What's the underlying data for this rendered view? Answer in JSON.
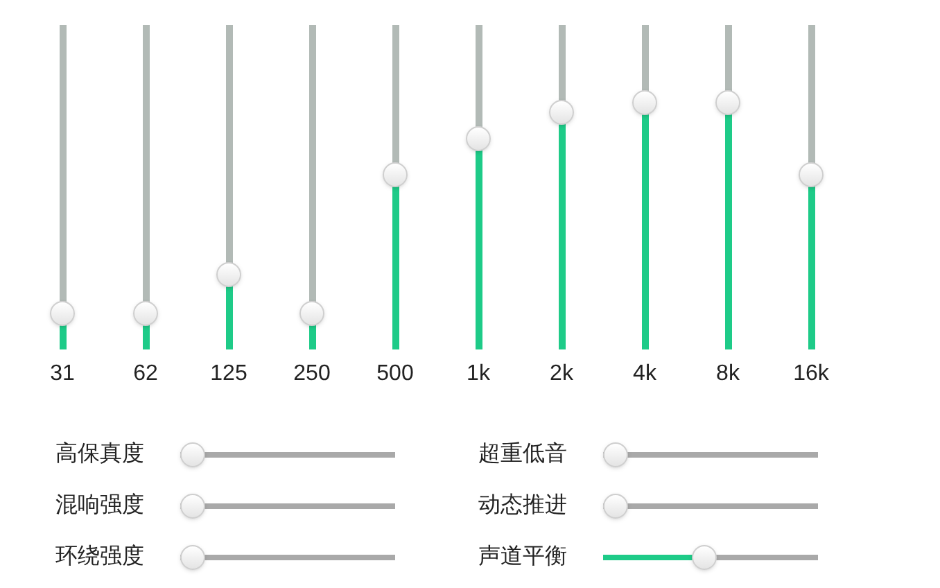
{
  "equalizer": [
    {
      "label": "31",
      "level": 0.11
    },
    {
      "label": "62",
      "level": 0.11
    },
    {
      "label": "125",
      "level": 0.23
    },
    {
      "label": "250",
      "level": 0.11
    },
    {
      "label": "500",
      "level": 0.54
    },
    {
      "label": "1k",
      "level": 0.65
    },
    {
      "label": "2k",
      "level": 0.73
    },
    {
      "label": "4k",
      "level": 0.76
    },
    {
      "label": "8k",
      "level": 0.76
    },
    {
      "label": "16k",
      "level": 0.54
    }
  ],
  "effects": [
    {
      "label": "高保真度",
      "level": 0
    },
    {
      "label": "超重低音",
      "level": 0
    },
    {
      "label": "混响强度",
      "level": 0
    },
    {
      "label": "动态推进",
      "level": 0
    },
    {
      "label": "环绕强度",
      "level": 0
    },
    {
      "label": "声道平衡",
      "level": 0.47
    }
  ]
}
